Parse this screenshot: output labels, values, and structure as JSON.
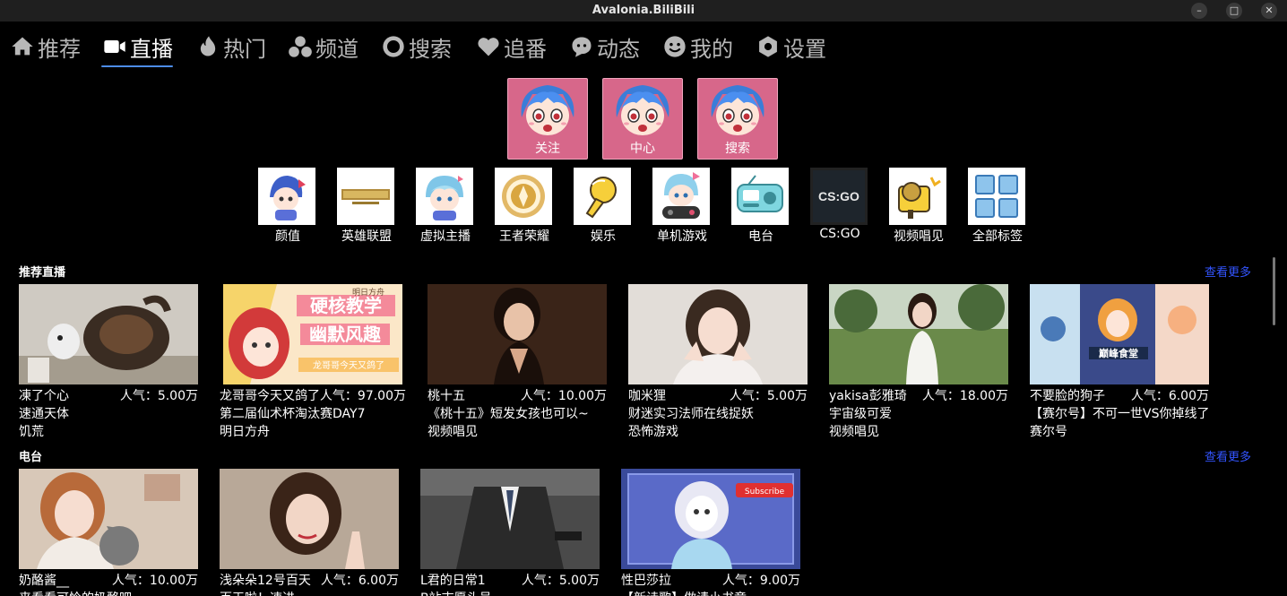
{
  "window": {
    "title": "Avalonia.BiliBili"
  },
  "nav": {
    "tabs": [
      {
        "label": "推荐",
        "icon": "home-icon"
      },
      {
        "label": "直播",
        "icon": "video-camera-icon"
      },
      {
        "label": "热门",
        "icon": "flame-icon"
      },
      {
        "label": "频道",
        "icon": "channels-icon"
      },
      {
        "label": "搜索",
        "icon": "search-icon"
      },
      {
        "label": "追番",
        "icon": "heart-icon"
      },
      {
        "label": "动态",
        "icon": "bubble-icon"
      },
      {
        "label": "我的",
        "icon": "smile-icon"
      },
      {
        "label": "设置",
        "icon": "gear-icon"
      }
    ],
    "active": "直播",
    "accent": "#4d8ce8"
  },
  "quick_buttons": [
    {
      "label": "关注"
    },
    {
      "label": "中心"
    },
    {
      "label": "搜索"
    }
  ],
  "categories": [
    {
      "label": "颜值",
      "icon": "cute-girl-icon"
    },
    {
      "label": "英雄联盟",
      "icon": "lol-logo-icon"
    },
    {
      "label": "虚拟主播",
      "icon": "vtuber-icon"
    },
    {
      "label": "王者荣耀",
      "icon": "honor-of-kings-icon"
    },
    {
      "label": "娱乐",
      "icon": "microphone-icon"
    },
    {
      "label": "单机游戏",
      "icon": "gamepad-girl-icon"
    },
    {
      "label": "电台",
      "icon": "radio-icon"
    },
    {
      "label": "CS:GO",
      "icon": "csgo-logo-icon",
      "logo_text": "CS:GO"
    },
    {
      "label": "视频唱见",
      "icon": "singer-icon"
    },
    {
      "label": "全部标签",
      "icon": "grid-icon"
    }
  ],
  "sections": [
    {
      "title": "推荐直播",
      "more": "查看更多",
      "cards": [
        {
          "name": "凍了个心",
          "popularity": "人气：5.00万",
          "title": "速通天体",
          "area": "饥荒"
        },
        {
          "name": "龙哥哥今天又鸽了",
          "popularity": "人气：97.00万",
          "title": "第二届仙术杯淘汰赛DAY7",
          "area": "明日方舟",
          "thumb_text": [
            "硬核教学",
            "幽默风趣",
            "龙哥哥今天又鸽了",
            "明日方舟"
          ]
        },
        {
          "name": "桃十五",
          "popularity": "人气：10.00万",
          "title": "《桃十五》短发女孩也可以~",
          "area": "视频唱见"
        },
        {
          "name": "咖米狸",
          "popularity": "人气：5.00万",
          "title": "财迷实习法师在线捉妖",
          "area": "恐怖游戏"
        },
        {
          "name": "yakisa彭雅琦",
          "popularity": "人气：18.00万",
          "title": "宇宙级可爱",
          "area": "视频唱见"
        },
        {
          "name": "不要脸的狗子",
          "popularity": "人气：6.00万",
          "title": "【赛尔号】不可一世VS你掉线了",
          "area": "赛尔号",
          "thumb_text": [
            "巅峰食堂"
          ]
        }
      ]
    },
    {
      "title": "电台",
      "more": "查看更多",
      "cards": [
        {
          "name": "奶酪酱__",
          "popularity": "人气：10.00万",
          "title": "来看看可怜的奶酪吧"
        },
        {
          "name": "浅朵朵12号百天",
          "popularity": "人气：6.00万",
          "title": "百天啦！速进"
        },
        {
          "name": "L君的日常1",
          "popularity": "人气：5.00万",
          "title": "B站志愿头号"
        },
        {
          "name": "性巴莎拉",
          "popularity": "人气：9.00万",
          "title": "【新诗歌】做请小书章",
          "thumb_text": [
            "Subscribe"
          ]
        }
      ]
    }
  ],
  "colors": {
    "background": "#000000",
    "titlebar": "#1f1f1f",
    "quick_button_bg": "#d7678a",
    "link": "#3355ff"
  }
}
